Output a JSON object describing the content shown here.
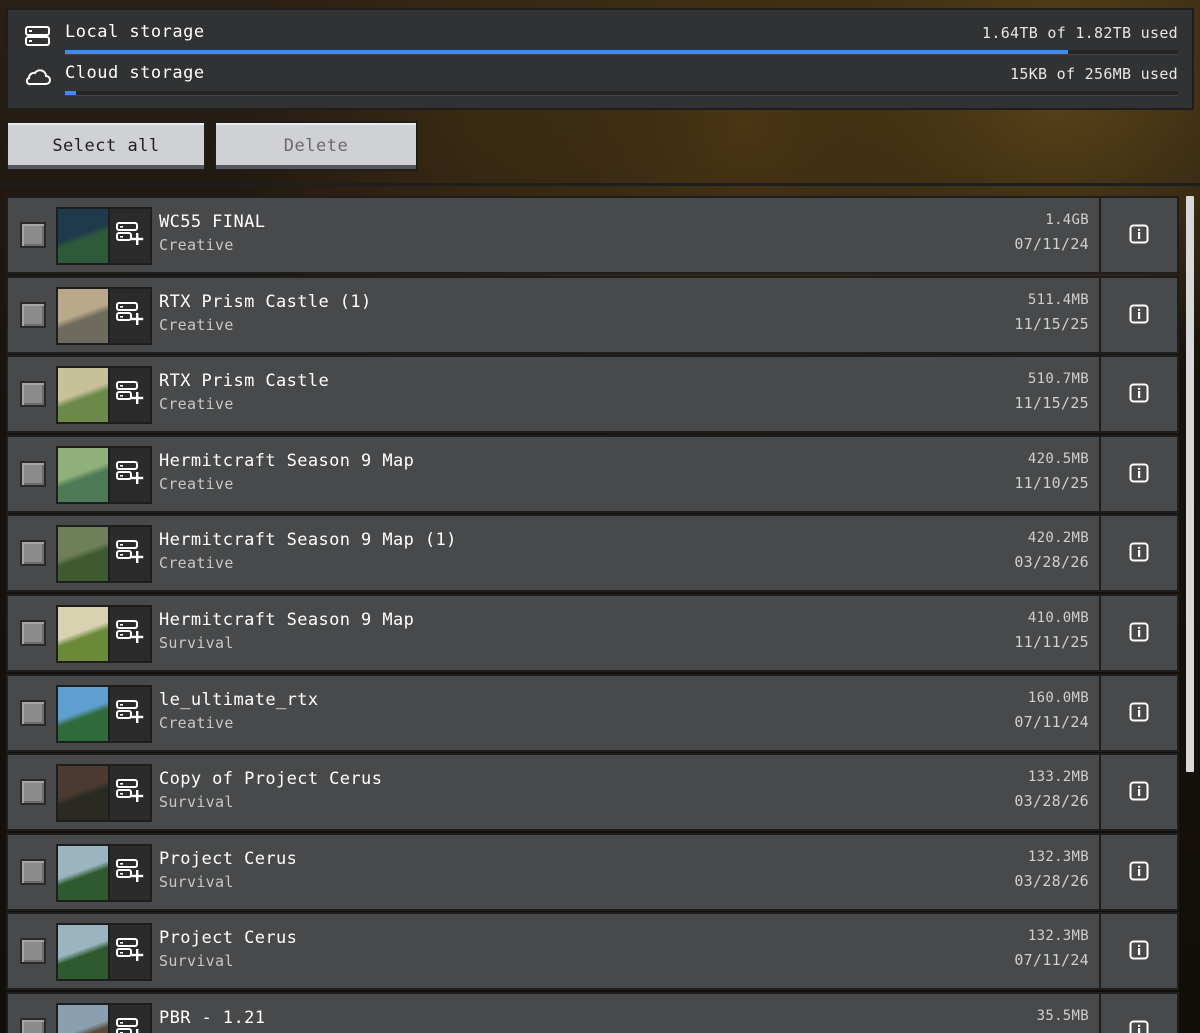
{
  "storage": {
    "local": {
      "label": "Local storage",
      "usage": "1.64TB of 1.82TB used",
      "fraction": 0.901,
      "icon": "server-icon"
    },
    "cloud": {
      "label": "Cloud storage",
      "usage": "15KB of 256MB used",
      "fraction": 0.01,
      "icon": "cloud-icon"
    }
  },
  "actions": {
    "select_all": "Select all",
    "delete": "Delete"
  },
  "accent": "#3c8af2",
  "worlds": [
    {
      "name": "WC55 FINAL",
      "mode": "Creative",
      "size": "1.4GB",
      "date": "07/11/24",
      "thumb": [
        "#1f3a4a",
        "#2f5a3a"
      ]
    },
    {
      "name": "RTX Prism Castle (1)",
      "mode": "Creative",
      "size": "511.4MB",
      "date": "11/15/25",
      "thumb": [
        "#b9a98a",
        "#6f6a5e"
      ]
    },
    {
      "name": "RTX Prism Castle",
      "mode": "Creative",
      "size": "510.7MB",
      "date": "11/15/25",
      "thumb": [
        "#c7c19a",
        "#6b8a4a"
      ]
    },
    {
      "name": "Hermitcraft Season 9 Map",
      "mode": "Creative",
      "size": "420.5MB",
      "date": "11/10/25",
      "thumb": [
        "#8fb07a",
        "#4e7a55"
      ]
    },
    {
      "name": "Hermitcraft Season 9 Map (1)",
      "mode": "Creative",
      "size": "420.2MB",
      "date": "03/28/26",
      "thumb": [
        "#6f7f5a",
        "#3f5a30"
      ]
    },
    {
      "name": "Hermitcraft Season 9 Map",
      "mode": "Survival",
      "size": "410.0MB",
      "date": "11/11/25",
      "thumb": [
        "#d9d2b0",
        "#6a8a3a"
      ]
    },
    {
      "name": "le_ultimate_rtx",
      "mode": "Creative",
      "size": "160.0MB",
      "date": "07/11/24",
      "thumb": [
        "#5f9fd0",
        "#2f6a3a"
      ]
    },
    {
      "name": "Copy of Project Cerus",
      "mode": "Survival",
      "size": "133.2MB",
      "date": "03/28/26",
      "thumb": [
        "#4a3a30",
        "#2a2a22"
      ]
    },
    {
      "name": "Project Cerus",
      "mode": "Survival",
      "size": "132.3MB",
      "date": "03/28/26",
      "thumb": [
        "#9ab5c0",
        "#2f5a2f"
      ]
    },
    {
      "name": "Project Cerus",
      "mode": "Survival",
      "size": "132.3MB",
      "date": "07/11/24",
      "thumb": [
        "#9ab5c0",
        "#2f5a2f"
      ]
    },
    {
      "name": "PBR - 1.21",
      "mode": "",
      "size": "35.5MB",
      "date": "",
      "thumb": [
        "#8aa0b0",
        "#5a4a3a"
      ]
    }
  ]
}
